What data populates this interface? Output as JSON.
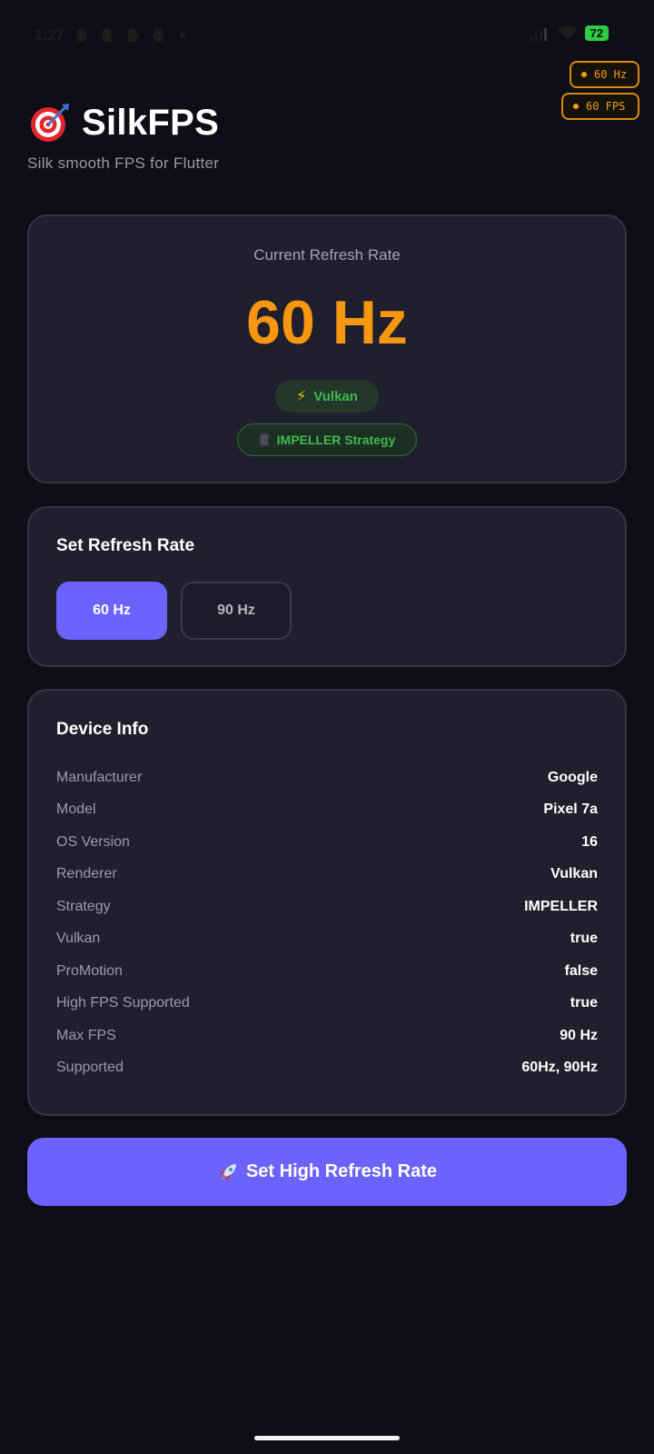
{
  "status_bar": {
    "time": "1:27",
    "notification_icons": [
      "snapchat-icon",
      "snapchat-icon",
      "snapchat-icon",
      "snapchat-icon"
    ],
    "battery_level": "72",
    "icons": [
      "signal-icon",
      "wifi-icon",
      "battery-icon",
      "charging-bolt-icon"
    ]
  },
  "overlays": {
    "hz": "60 Hz",
    "fps": "60 FPS",
    "color": "#f39c12"
  },
  "header": {
    "title": "SilkFPS",
    "subtitle": "Silk smooth FPS for Flutter",
    "icon": "target-icon"
  },
  "refresh_card": {
    "label": "Current Refresh Rate",
    "value": "60 Hz",
    "renderer_chip": "Vulkan",
    "renderer_chip_icon": "lightning-bolt-icon",
    "strategy_chip": "IMPELLER Strategy",
    "strategy_chip_icon": "mobile-phone-icon",
    "accent": "#f7960f",
    "chip_color": "#3dba4e"
  },
  "set_rate_card": {
    "title": "Set Refresh Rate",
    "options": [
      "60 Hz",
      "90 Hz"
    ],
    "selected": "60 Hz",
    "selected_color": "#6c63ff"
  },
  "device_info": {
    "title": "Device Info",
    "rows": [
      {
        "key": "Manufacturer",
        "value": "Google"
      },
      {
        "key": "Model",
        "value": "Pixel 7a"
      },
      {
        "key": "OS Version",
        "value": "16"
      },
      {
        "key": "Renderer",
        "value": "Vulkan"
      },
      {
        "key": "Strategy",
        "value": "IMPELLER"
      },
      {
        "key": "Vulkan",
        "value": "true"
      },
      {
        "key": "ProMotion",
        "value": "false"
      },
      {
        "key": "High FPS Supported",
        "value": "true"
      },
      {
        "key": "Max FPS",
        "value": "90 Hz"
      },
      {
        "key": "Supported",
        "value": "60Hz, 90Hz"
      }
    ]
  },
  "cta": {
    "label": "Set High Refresh Rate",
    "icon": "rocket-icon"
  }
}
